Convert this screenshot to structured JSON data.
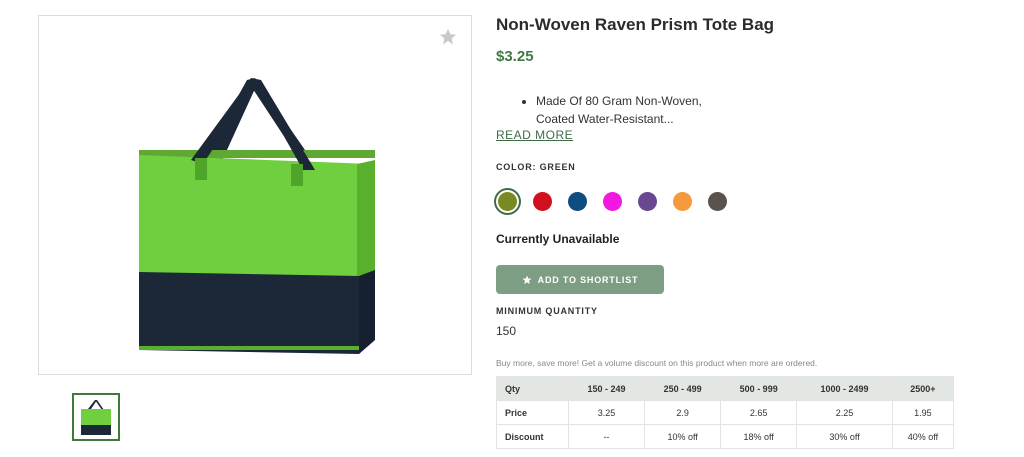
{
  "product": {
    "title": "Non-Woven Raven Prism Tote Bag",
    "price": "$3.25",
    "description_line1": "Made Of 80 Gram Non-Woven,",
    "description_line2": "Coated Water-Resistant...",
    "read_more": "READ MORE",
    "color_label": "COLOR: GREEN",
    "availability": "Currently Unavailable",
    "shortlist_label": "ADD TO SHORTLIST",
    "min_qty_label": "MINIMUM QUANTITY",
    "min_qty_value": "150",
    "volume_note": "Buy more, save more! Get a volume discount on this product when more are ordered."
  },
  "colors": [
    {
      "name": "green",
      "hex": "#7a8a22",
      "selected": true
    },
    {
      "name": "red",
      "hex": "#d0101e",
      "selected": false
    },
    {
      "name": "navy",
      "hex": "#0f4c80",
      "selected": false
    },
    {
      "name": "magenta",
      "hex": "#f318e0",
      "selected": false
    },
    {
      "name": "purple",
      "hex": "#6a4791",
      "selected": false
    },
    {
      "name": "orange",
      "hex": "#f5993c",
      "selected": false
    },
    {
      "name": "gray",
      "hex": "#5a534b",
      "selected": false
    }
  ],
  "pricing_table": {
    "headers": [
      "Qty",
      "150 - 249",
      "250 - 499",
      "500 - 999",
      "1000 - 2499",
      "2500+"
    ],
    "rows": [
      [
        "Price",
        "3.25",
        "2.9",
        "2.65",
        "2.25",
        "1.95"
      ],
      [
        "Discount",
        "--",
        "10% off",
        "18% off",
        "30% off",
        "40% off"
      ]
    ]
  },
  "icons": {
    "favorite": "star-icon",
    "shortlist": "star-icon"
  },
  "accent_colors": {
    "price": "#3f7a46",
    "button": "#7d9e82",
    "bag_green": "#6fcf3f",
    "bag_navy": "#1c2738"
  }
}
